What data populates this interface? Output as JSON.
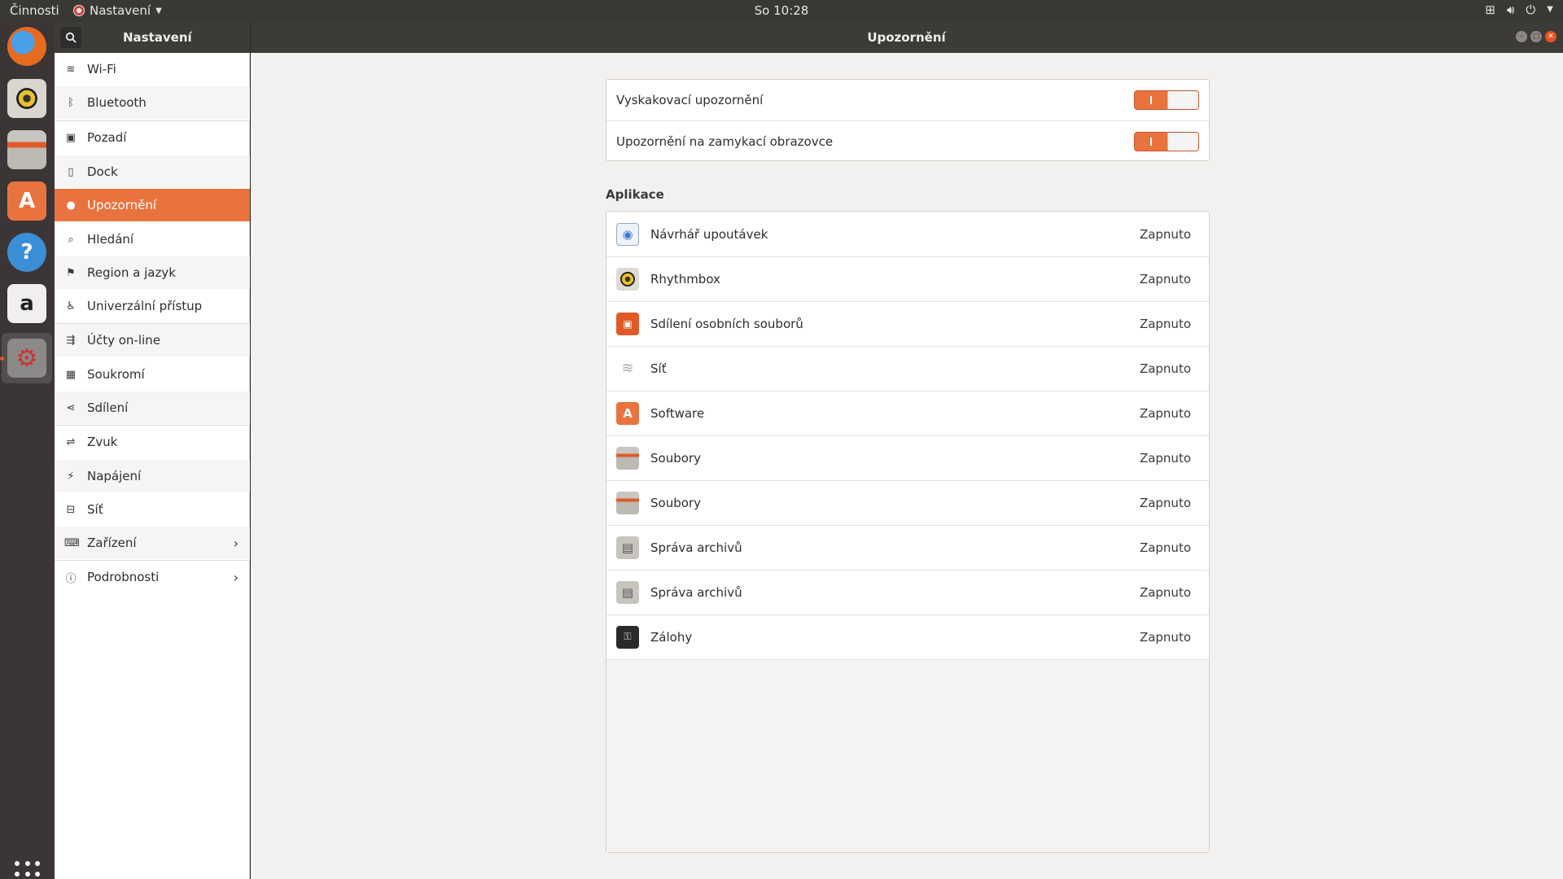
{
  "topbar": {
    "activities": "Činnosti",
    "app_menu": "Nastavení",
    "clock": "So 10:28"
  },
  "header": {
    "sidebar_title": "Nastavení",
    "main_title": "Upozornění"
  },
  "sidebar": {
    "items": [
      {
        "label": "Wi-Fi",
        "icon": "wifi-icon"
      },
      {
        "label": "Bluetooth",
        "icon": "bluetooth-icon"
      },
      {
        "label": "Pozadí",
        "icon": "background-icon"
      },
      {
        "label": "Dock",
        "icon": "dock-icon"
      },
      {
        "label": "Upozornění",
        "icon": "notifications-icon",
        "selected": true
      },
      {
        "label": "Hledání",
        "icon": "search-icon"
      },
      {
        "label": "Region a jazyk",
        "icon": "region-icon"
      },
      {
        "label": "Univerzální přístup",
        "icon": "accessibility-icon"
      },
      {
        "label": "Účty on-line",
        "icon": "online-accounts-icon"
      },
      {
        "label": "Soukromí",
        "icon": "privacy-icon"
      },
      {
        "label": "Sdílení",
        "icon": "sharing-icon"
      },
      {
        "label": "Zvuk",
        "icon": "sound-icon"
      },
      {
        "label": "Napájení",
        "icon": "power-icon"
      },
      {
        "label": "Síť",
        "icon": "network-icon"
      },
      {
        "label": "Zařízení",
        "icon": "devices-icon",
        "has_submenu": true
      },
      {
        "label": "Podrobnosti",
        "icon": "details-icon",
        "has_submenu": true
      }
    ]
  },
  "main": {
    "toggles": [
      {
        "label": "Vyskakovací upozornění",
        "on": true
      },
      {
        "label": "Upozornění na zamykací obrazovce",
        "on": true
      }
    ],
    "section_label": "Aplikace",
    "apps": [
      {
        "name": "Návrhář upoutávek",
        "status": "Zapnuto",
        "icon": "poster-designer-icon"
      },
      {
        "name": "Rhythmbox",
        "status": "Zapnuto",
        "icon": "rhythmbox-icon"
      },
      {
        "name": "Sdílení osobních souborů",
        "status": "Zapnuto",
        "icon": "file-sharing-icon"
      },
      {
        "name": "Síť",
        "status": "Zapnuto",
        "icon": "network-wifi-icon"
      },
      {
        "name": "Software",
        "status": "Zapnuto",
        "icon": "software-icon"
      },
      {
        "name": "Soubory",
        "status": "Zapnuto",
        "icon": "files-icon"
      },
      {
        "name": "Soubory",
        "status": "Zapnuto",
        "icon": "files-icon"
      },
      {
        "name": "Správa archivů",
        "status": "Zapnuto",
        "icon": "archive-manager-icon"
      },
      {
        "name": "Správa archivů",
        "status": "Zapnuto",
        "icon": "archive-manager-icon"
      },
      {
        "name": "Zálohy",
        "status": "Zapnuto",
        "icon": "backups-icon"
      }
    ]
  },
  "colors": {
    "accent": "#e9733f",
    "topbar": "#3a3835",
    "dock": "#3b3536"
  }
}
